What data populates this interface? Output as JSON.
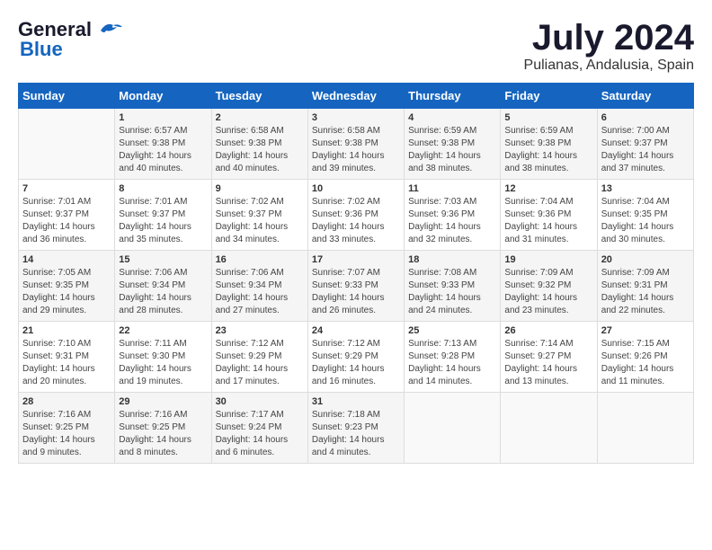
{
  "logo": {
    "line1": "General",
    "line2": "Blue"
  },
  "title": "July 2024",
  "subtitle": "Pulianas, Andalusia, Spain",
  "days_header": [
    "Sunday",
    "Monday",
    "Tuesday",
    "Wednesday",
    "Thursday",
    "Friday",
    "Saturday"
  ],
  "weeks": [
    [
      {
        "day": "",
        "sunrise": "",
        "sunset": "",
        "daylight": ""
      },
      {
        "day": "1",
        "sunrise": "Sunrise: 6:57 AM",
        "sunset": "Sunset: 9:38 PM",
        "daylight": "Daylight: 14 hours and 40 minutes."
      },
      {
        "day": "2",
        "sunrise": "Sunrise: 6:58 AM",
        "sunset": "Sunset: 9:38 PM",
        "daylight": "Daylight: 14 hours and 40 minutes."
      },
      {
        "day": "3",
        "sunrise": "Sunrise: 6:58 AM",
        "sunset": "Sunset: 9:38 PM",
        "daylight": "Daylight: 14 hours and 39 minutes."
      },
      {
        "day": "4",
        "sunrise": "Sunrise: 6:59 AM",
        "sunset": "Sunset: 9:38 PM",
        "daylight": "Daylight: 14 hours and 38 minutes."
      },
      {
        "day": "5",
        "sunrise": "Sunrise: 6:59 AM",
        "sunset": "Sunset: 9:38 PM",
        "daylight": "Daylight: 14 hours and 38 minutes."
      },
      {
        "day": "6",
        "sunrise": "Sunrise: 7:00 AM",
        "sunset": "Sunset: 9:37 PM",
        "daylight": "Daylight: 14 hours and 37 minutes."
      }
    ],
    [
      {
        "day": "7",
        "sunrise": "Sunrise: 7:01 AM",
        "sunset": "Sunset: 9:37 PM",
        "daylight": "Daylight: 14 hours and 36 minutes."
      },
      {
        "day": "8",
        "sunrise": "Sunrise: 7:01 AM",
        "sunset": "Sunset: 9:37 PM",
        "daylight": "Daylight: 14 hours and 35 minutes."
      },
      {
        "day": "9",
        "sunrise": "Sunrise: 7:02 AM",
        "sunset": "Sunset: 9:37 PM",
        "daylight": "Daylight: 14 hours and 34 minutes."
      },
      {
        "day": "10",
        "sunrise": "Sunrise: 7:02 AM",
        "sunset": "Sunset: 9:36 PM",
        "daylight": "Daylight: 14 hours and 33 minutes."
      },
      {
        "day": "11",
        "sunrise": "Sunrise: 7:03 AM",
        "sunset": "Sunset: 9:36 PM",
        "daylight": "Daylight: 14 hours and 32 minutes."
      },
      {
        "day": "12",
        "sunrise": "Sunrise: 7:04 AM",
        "sunset": "Sunset: 9:36 PM",
        "daylight": "Daylight: 14 hours and 31 minutes."
      },
      {
        "day": "13",
        "sunrise": "Sunrise: 7:04 AM",
        "sunset": "Sunset: 9:35 PM",
        "daylight": "Daylight: 14 hours and 30 minutes."
      }
    ],
    [
      {
        "day": "14",
        "sunrise": "Sunrise: 7:05 AM",
        "sunset": "Sunset: 9:35 PM",
        "daylight": "Daylight: 14 hours and 29 minutes."
      },
      {
        "day": "15",
        "sunrise": "Sunrise: 7:06 AM",
        "sunset": "Sunset: 9:34 PM",
        "daylight": "Daylight: 14 hours and 28 minutes."
      },
      {
        "day": "16",
        "sunrise": "Sunrise: 7:06 AM",
        "sunset": "Sunset: 9:34 PM",
        "daylight": "Daylight: 14 hours and 27 minutes."
      },
      {
        "day": "17",
        "sunrise": "Sunrise: 7:07 AM",
        "sunset": "Sunset: 9:33 PM",
        "daylight": "Daylight: 14 hours and 26 minutes."
      },
      {
        "day": "18",
        "sunrise": "Sunrise: 7:08 AM",
        "sunset": "Sunset: 9:33 PM",
        "daylight": "Daylight: 14 hours and 24 minutes."
      },
      {
        "day": "19",
        "sunrise": "Sunrise: 7:09 AM",
        "sunset": "Sunset: 9:32 PM",
        "daylight": "Daylight: 14 hours and 23 minutes."
      },
      {
        "day": "20",
        "sunrise": "Sunrise: 7:09 AM",
        "sunset": "Sunset: 9:31 PM",
        "daylight": "Daylight: 14 hours and 22 minutes."
      }
    ],
    [
      {
        "day": "21",
        "sunrise": "Sunrise: 7:10 AM",
        "sunset": "Sunset: 9:31 PM",
        "daylight": "Daylight: 14 hours and 20 minutes."
      },
      {
        "day": "22",
        "sunrise": "Sunrise: 7:11 AM",
        "sunset": "Sunset: 9:30 PM",
        "daylight": "Daylight: 14 hours and 19 minutes."
      },
      {
        "day": "23",
        "sunrise": "Sunrise: 7:12 AM",
        "sunset": "Sunset: 9:29 PM",
        "daylight": "Daylight: 14 hours and 17 minutes."
      },
      {
        "day": "24",
        "sunrise": "Sunrise: 7:12 AM",
        "sunset": "Sunset: 9:29 PM",
        "daylight": "Daylight: 14 hours and 16 minutes."
      },
      {
        "day": "25",
        "sunrise": "Sunrise: 7:13 AM",
        "sunset": "Sunset: 9:28 PM",
        "daylight": "Daylight: 14 hours and 14 minutes."
      },
      {
        "day": "26",
        "sunrise": "Sunrise: 7:14 AM",
        "sunset": "Sunset: 9:27 PM",
        "daylight": "Daylight: 14 hours and 13 minutes."
      },
      {
        "day": "27",
        "sunrise": "Sunrise: 7:15 AM",
        "sunset": "Sunset: 9:26 PM",
        "daylight": "Daylight: 14 hours and 11 minutes."
      }
    ],
    [
      {
        "day": "28",
        "sunrise": "Sunrise: 7:16 AM",
        "sunset": "Sunset: 9:25 PM",
        "daylight": "Daylight: 14 hours and 9 minutes."
      },
      {
        "day": "29",
        "sunrise": "Sunrise: 7:16 AM",
        "sunset": "Sunset: 9:25 PM",
        "daylight": "Daylight: 14 hours and 8 minutes."
      },
      {
        "day": "30",
        "sunrise": "Sunrise: 7:17 AM",
        "sunset": "Sunset: 9:24 PM",
        "daylight": "Daylight: 14 hours and 6 minutes."
      },
      {
        "day": "31",
        "sunrise": "Sunrise: 7:18 AM",
        "sunset": "Sunset: 9:23 PM",
        "daylight": "Daylight: 14 hours and 4 minutes."
      },
      {
        "day": "",
        "sunrise": "",
        "sunset": "",
        "daylight": ""
      },
      {
        "day": "",
        "sunrise": "",
        "sunset": "",
        "daylight": ""
      },
      {
        "day": "",
        "sunrise": "",
        "sunset": "",
        "daylight": ""
      }
    ]
  ]
}
